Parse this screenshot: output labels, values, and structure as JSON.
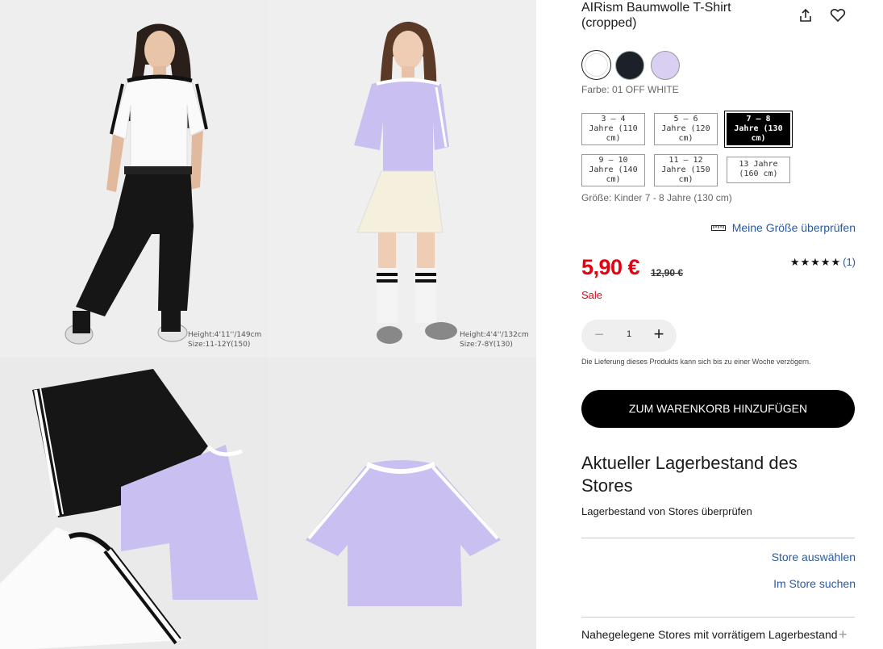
{
  "gallery": {
    "captions": [
      {
        "height": "Height:4'11''/149cm",
        "size": "Size:11-12Y(150)"
      },
      {
        "height": "Height:4'4''/132cm",
        "size": "Size:7-8Y(130)"
      }
    ]
  },
  "product": {
    "title": "AIRism Baumwolle T-Shirt (cropped)",
    "colors": [
      {
        "name": "OFF WHITE",
        "hex": "#ffffff"
      },
      {
        "name": "NAVY",
        "hex": "#1c2129"
      },
      {
        "name": "PURPLE",
        "hex": "#d9cff3"
      }
    ],
    "color_label": "Farbe: 01 OFF WHITE",
    "sizes": [
      {
        "label": "3 – 4\nJahre (110\ncm)",
        "selected": false
      },
      {
        "label": "5 – 6\nJahre (120\ncm)",
        "selected": false
      },
      {
        "label": "7 – 8\nJahre (130\ncm)",
        "selected": true
      },
      {
        "label": "9 – 10\nJahre (140\ncm)",
        "selected": false
      },
      {
        "label": "11 – 12\nJahre (150\ncm)",
        "selected": false
      },
      {
        "label": "13 Jahre\n(160 cm)",
        "selected": false
      }
    ],
    "size_label": "Größe: Kinder 7 - 8 Jahre (130 cm)",
    "check_size": "Meine Größe überprüfen",
    "price": "5,90 €",
    "old_price": "12,90 €",
    "sale": "Sale",
    "rating_stars": "★★★★★",
    "rating_count": "(1)",
    "quantity": "1",
    "delivery_note": "Die Lieferung dieses Produkts kann sich bis zu einer Woche verzögern.",
    "cart_button": "ZUM WARENKORB HINZUFÜGEN"
  },
  "stock": {
    "heading": "Aktueller Lagerbestand des Stores",
    "subheading": "Lagerbestand von Stores überprüfen",
    "select_store": "Store auswählen",
    "search_store": "Im Store suchen",
    "nearby": "Nahegelegene Stores mit vorrätigem Lagerbestand"
  },
  "colors": {
    "accent_red": "#e60012",
    "link_blue": "#2b5a9e"
  }
}
